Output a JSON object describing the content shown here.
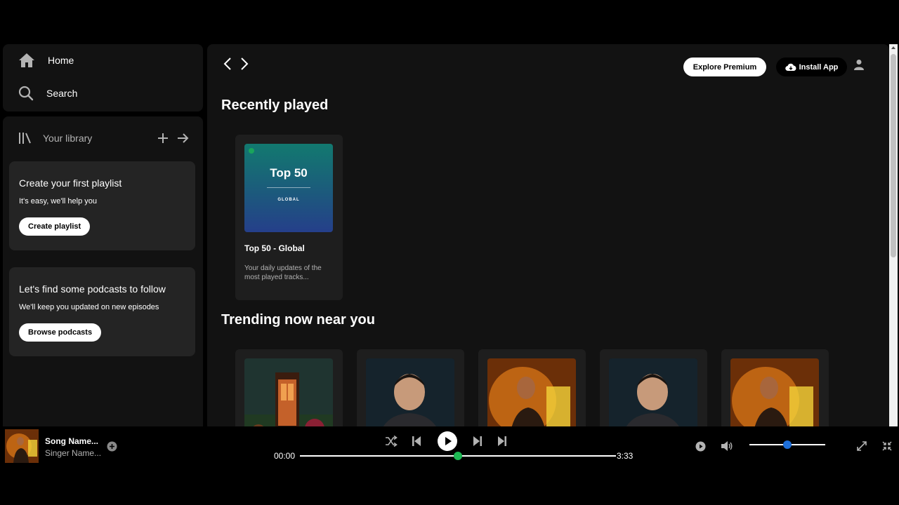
{
  "nav": {
    "home": "Home",
    "search": "Search"
  },
  "library": {
    "title": "Your library",
    "playlist_card": {
      "title": "Create your first playlist",
      "text": "It's easy, we'll help you",
      "button": "Create playlist"
    },
    "podcast_card": {
      "title": "Let's find some podcasts to follow",
      "text": "We'll keep you updated on new episodes",
      "button": "Browse podcasts"
    }
  },
  "header": {
    "premium": "Explore Premium",
    "install": "Install App"
  },
  "recent": {
    "title": "Recently played",
    "items": [
      {
        "cover_title": "Top 50",
        "cover_sub": "GLOBAL",
        "title": "Top 50 - Global",
        "desc": "Your daily updates of the most played tracks..."
      }
    ]
  },
  "trending": {
    "title": "Trending now near you"
  },
  "player": {
    "song": "Song Name...",
    "singer": "Singer Name...",
    "current_time": "00:00",
    "total_time": "3:33",
    "progress": 0.5,
    "volume": 0.5
  },
  "colors": {
    "accent": "#1db954",
    "volume_knob": "#1e6fd9",
    "background": "#121212",
    "card": "#242424"
  }
}
